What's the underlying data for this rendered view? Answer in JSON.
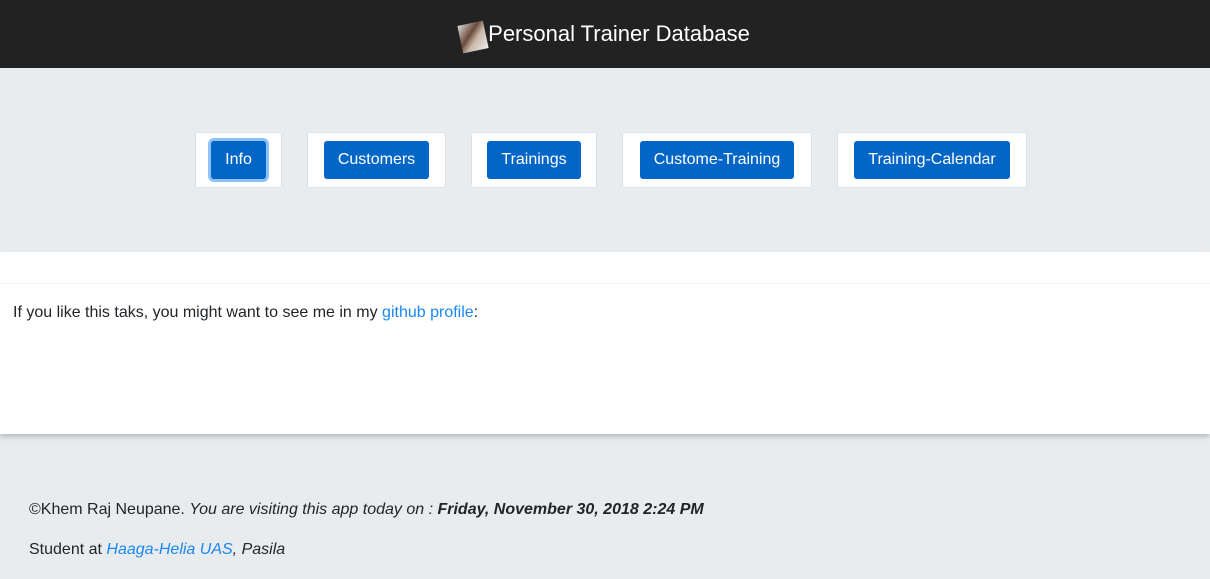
{
  "header": {
    "title": "Personal Trainer Database",
    "logo_icon": "trainer-logo-icon"
  },
  "nav": {
    "buttons": [
      "Info",
      "Customers",
      "Trainings",
      "Custome-Training",
      "Training-Calendar"
    ],
    "active": "Info"
  },
  "content": {
    "text_before": "If you like this taks, you might want to see me in my ",
    "link": "github profile",
    "text_after": ":"
  },
  "footer": {
    "author": "©Khem Raj Neupane. ",
    "visiting": "You are visiting this app today on : ",
    "date": "Friday, November 30, 2018 2:24 PM",
    "student_prefix": "Student at ",
    "school": "Haaga-Helia UAS",
    "campus": ", Pasila"
  },
  "colors": {
    "accent": "#0366c6",
    "link": "#1a88f0",
    "header_bg": "#222222"
  }
}
